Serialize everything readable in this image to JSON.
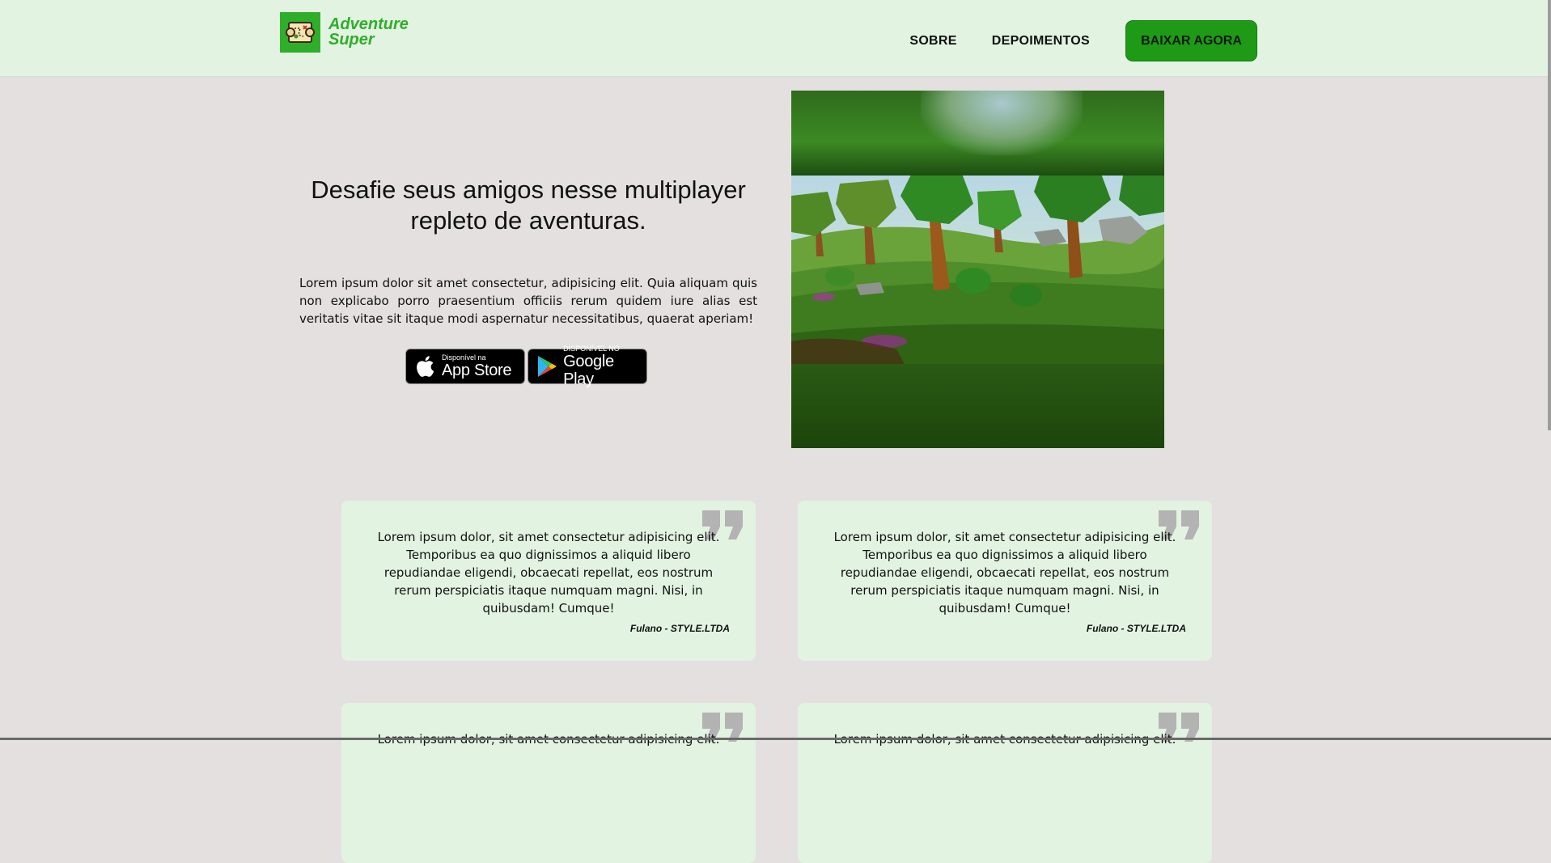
{
  "header": {
    "logo_line1": "Adventure",
    "logo_line2": "Super",
    "nav": [
      {
        "label": "SOBRE"
      },
      {
        "label": "DEPOIMENTOS"
      }
    ],
    "cta_label": "BAIXAR AGORA"
  },
  "hero": {
    "title": "Desafie seus amigos nesse multiplayer repleto de aventuras.",
    "text": "Lorem ipsum dolor sit amet consectetur, adipisicing elit. Quia aliquam quis non explicabo porro praesentium officiis rerum quidem iure alias est veritatis vitae sit itaque modi aspernatur necessitatibus, quaerat aperiam!",
    "app_store": {
      "small": "Disponível na",
      "big": "App Store"
    },
    "google_play": {
      "small": "DISPONÍVEL NO",
      "big": "Google Play"
    }
  },
  "testimonials": [
    {
      "text": "Lorem ipsum dolor, sit amet consectetur adipisicing elit. Temporibus ea quo dignissimos a aliquid libero repudiandae eligendi, obcaecati repellat, eos nostrum rerum perspiciatis itaque numquam magni. Nisi, in quibusdam! Cumque!",
      "author": "Fulano - STYLE.LTDA"
    },
    {
      "text": "Lorem ipsum dolor, sit amet consectetur adipisicing elit. Temporibus ea quo dignissimos a aliquid libero repudiandae eligendi, obcaecati repellat, eos nostrum rerum perspiciatis itaque numquam magni. Nisi, in quibusdam! Cumque!",
      "author": "Fulano - STYLE.LTDA"
    },
    {
      "text": "Lorem ipsum dolor, sit amet consectetur adipisicing elit.",
      "author": ""
    },
    {
      "text": "Lorem ipsum dolor, sit amet consectetur adipisicing elit.",
      "author": ""
    }
  ],
  "colors": {
    "header_bg": "#e2f3e1",
    "page_bg": "#e3e0df",
    "brand_green": "#2fae2a",
    "cta_green": "#1e9a17",
    "card_bg": "#e2f3e1"
  },
  "icons": {
    "logo": "treasure-map-icon",
    "quote": "quote-icon",
    "apple": "apple-icon",
    "play": "google-play-icon"
  }
}
